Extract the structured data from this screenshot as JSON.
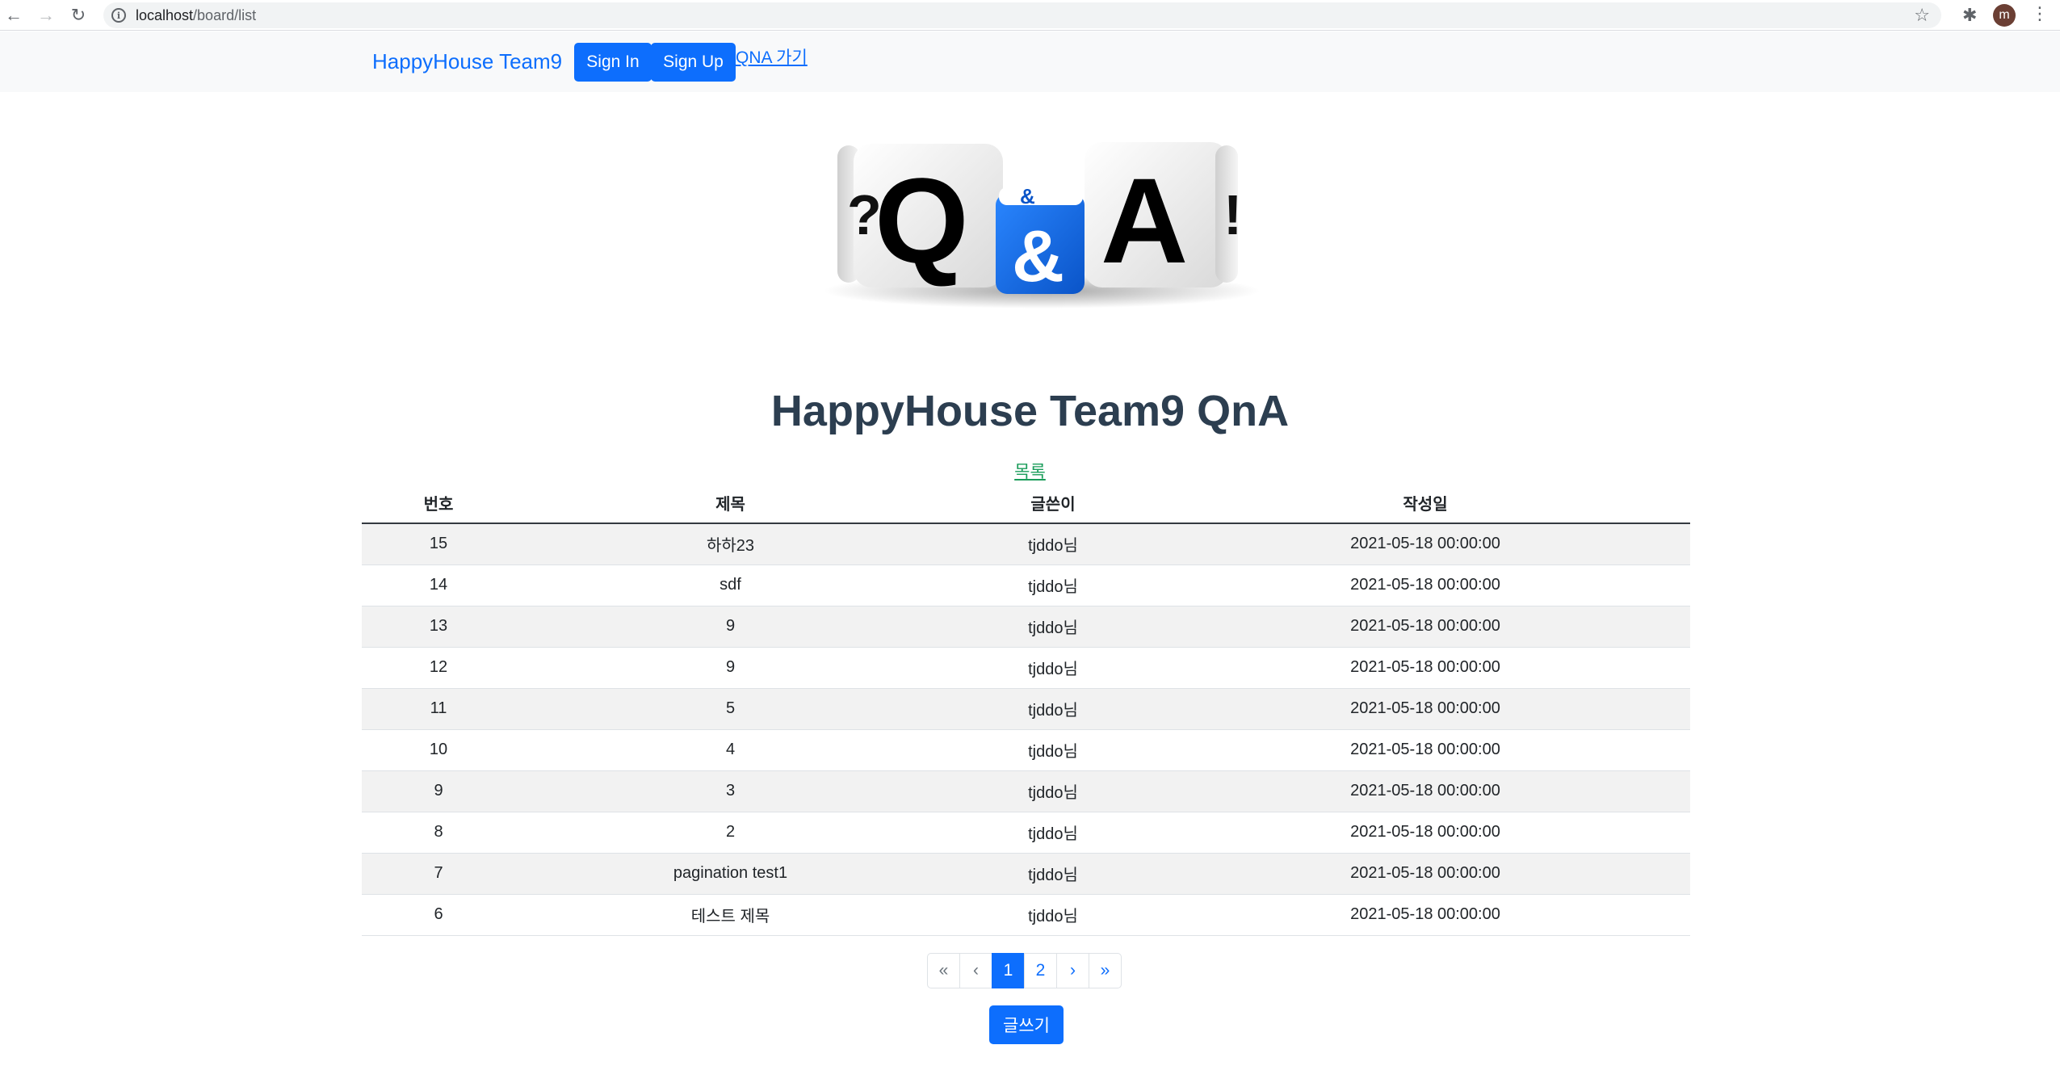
{
  "browser": {
    "url_host": "localhost",
    "url_path": "/board/list",
    "avatar_letter": "m"
  },
  "navbar": {
    "brand": "HappyHouse Team9",
    "signin_label": "Sign In",
    "signup_label": "Sign Up",
    "qna_link": "QNA 가기"
  },
  "logo": {
    "letters": [
      "?",
      "Q",
      "&",
      "A",
      "!"
    ],
    "accent_color": "#0d6efd"
  },
  "main": {
    "title": "HappyHouse Team9 QnA",
    "list_link": "목록",
    "columns": [
      "번호",
      "제목",
      "글쓴이",
      "작성일"
    ],
    "rows": [
      {
        "no": "15",
        "title": "하하23",
        "writer": "tjddo님",
        "date": "2021-05-18 00:00:00"
      },
      {
        "no": "14",
        "title": "sdf",
        "writer": "tjddo님",
        "date": "2021-05-18 00:00:00"
      },
      {
        "no": "13",
        "title": "9",
        "writer": "tjddo님",
        "date": "2021-05-18 00:00:00"
      },
      {
        "no": "12",
        "title": "9",
        "writer": "tjddo님",
        "date": "2021-05-18 00:00:00"
      },
      {
        "no": "11",
        "title": "5",
        "writer": "tjddo님",
        "date": "2021-05-18 00:00:00"
      },
      {
        "no": "10",
        "title": "4",
        "writer": "tjddo님",
        "date": "2021-05-18 00:00:00"
      },
      {
        "no": "9",
        "title": "3",
        "writer": "tjddo님",
        "date": "2021-05-18 00:00:00"
      },
      {
        "no": "8",
        "title": "2",
        "writer": "tjddo님",
        "date": "2021-05-18 00:00:00"
      },
      {
        "no": "7",
        "title": "pagination test1",
        "writer": "tjddo님",
        "date": "2021-05-18 00:00:00"
      },
      {
        "no": "6",
        "title": "테스트 제목",
        "writer": "tjddo님",
        "date": "2021-05-18 00:00:00"
      }
    ],
    "pagination": {
      "first": "«",
      "prev": "‹",
      "pages": [
        "1",
        "2"
      ],
      "current": "1",
      "next": "›",
      "last": "»"
    },
    "write_label": "글쓰기"
  },
  "colors": {
    "primary": "#0d6efd",
    "title": "#2c3e50",
    "list_link": "#1a9c5a",
    "stripe": "#f2f2f2"
  }
}
